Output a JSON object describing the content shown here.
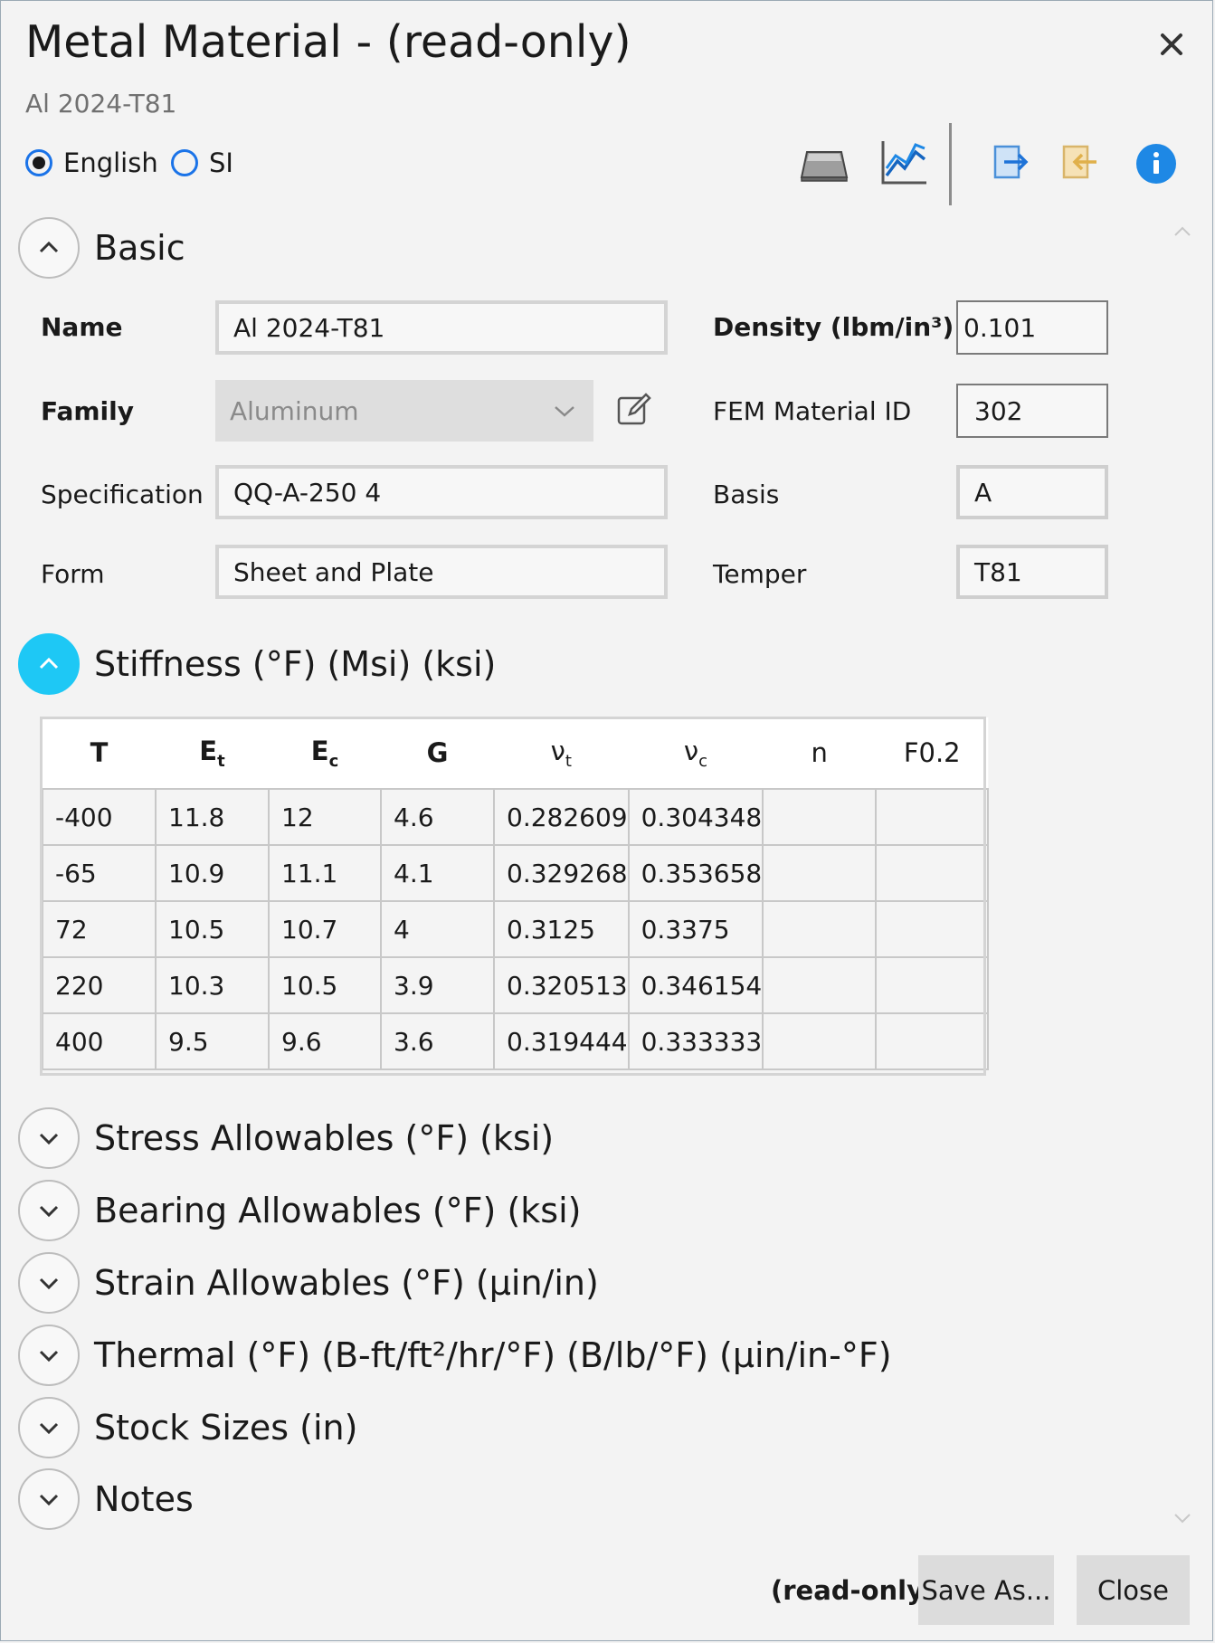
{
  "window": {
    "title": "Metal Material - (read-only)",
    "subtitle": "Al 2024-T81"
  },
  "units": {
    "english_label": "English",
    "si_label": "SI",
    "selected": "English"
  },
  "sections": {
    "basic": "Basic",
    "stiffness": "Stiffness (°F) (Msi) (ksi)",
    "stress": "Stress Allowables (°F) (ksi)",
    "bearing": "Bearing Allowables (°F) (ksi)",
    "strain": "Strain Allowables (°F) (µin/in)",
    "thermal": "Thermal (°F) (B-ft/ft²/hr/°F) (B/lb/°F) (µin/in-°F)",
    "stock": "Stock Sizes (in)",
    "notes": "Notes"
  },
  "basic": {
    "name_label": "Name",
    "name_value": "Al 2024-T81",
    "family_label": "Family",
    "family_value": "Aluminum",
    "spec_label": "Specification",
    "spec_value": "QQ-A-250 4",
    "form_label": "Form",
    "form_value": "Sheet and Plate",
    "density_label": "Density (lbm/in³)",
    "density_value": "0.101",
    "fem_label": "FEM Material ID",
    "fem_value": "302",
    "basis_label": "Basis",
    "basis_value": "A",
    "temper_label": "Temper",
    "temper_value": "T81"
  },
  "stiffness": {
    "headers": [
      {
        "main": "T",
        "sub": ""
      },
      {
        "main": "E",
        "sub": "t"
      },
      {
        "main": "E",
        "sub": "c"
      },
      {
        "main": "G",
        "sub": ""
      },
      {
        "main": "ν",
        "sub": "t"
      },
      {
        "main": "ν",
        "sub": "c"
      },
      {
        "main": "n",
        "sub": ""
      },
      {
        "main": "F0.2",
        "sub": ""
      }
    ],
    "rows": [
      [
        "-400",
        "11.8",
        "12",
        "4.6",
        "0.282609",
        "0.304348",
        "",
        ""
      ],
      [
        "-65",
        "10.9",
        "11.1",
        "4.1",
        "0.329268",
        "0.353658",
        "",
        ""
      ],
      [
        "72",
        "10.5",
        "10.7",
        "4",
        "0.3125",
        "0.3375",
        "",
        ""
      ],
      [
        "220",
        "10.3",
        "10.5",
        "3.9",
        "0.320513",
        "0.346154",
        "",
        ""
      ],
      [
        "400",
        "9.5",
        "9.6",
        "3.6",
        "0.319444",
        "0.333333",
        "",
        ""
      ]
    ]
  },
  "footer": {
    "readonly_label": "(read-only)",
    "save_as_label": "Save As...",
    "close_label": "Close"
  },
  "colors": {
    "accent": "#1ec8f5",
    "radio": "#1a73e8",
    "info": "#1e88e5"
  }
}
